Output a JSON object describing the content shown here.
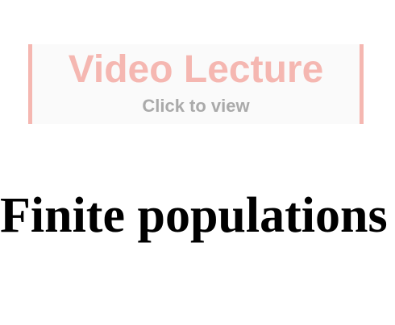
{
  "video": {
    "title": "Video Lecture",
    "subtitle": "Click to view",
    "accent": "#f5b7b1"
  },
  "heading": "Finite populations"
}
